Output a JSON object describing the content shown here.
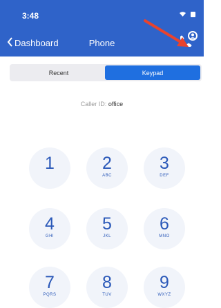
{
  "status_bar": {
    "time": "3:48"
  },
  "nav": {
    "back_label": "Dashboard",
    "title": "Phone"
  },
  "segments": {
    "recent_label": "Recent",
    "keypad_label": "Keypad"
  },
  "caller_id": {
    "prefix": "Caller ID:",
    "value": "office"
  },
  "keypad": [
    {
      "digit": "1",
      "letters": ""
    },
    {
      "digit": "2",
      "letters": "ABC"
    },
    {
      "digit": "3",
      "letters": "DEF"
    },
    {
      "digit": "4",
      "letters": "GHI"
    },
    {
      "digit": "5",
      "letters": "JKL"
    },
    {
      "digit": "6",
      "letters": "MNO"
    },
    {
      "digit": "7",
      "letters": "PQRS"
    },
    {
      "digit": "8",
      "letters": "TUV"
    },
    {
      "digit": "9",
      "letters": "WXYZ"
    }
  ],
  "colors": {
    "header": "#2f63c9",
    "accent": "#1f6fe0",
    "annotation_arrow": "#e8432e"
  },
  "icons": [
    "wifi-icon",
    "battery-icon",
    "chevron-left-icon",
    "caller-id-icon",
    "arrow-annotation-icon"
  ]
}
